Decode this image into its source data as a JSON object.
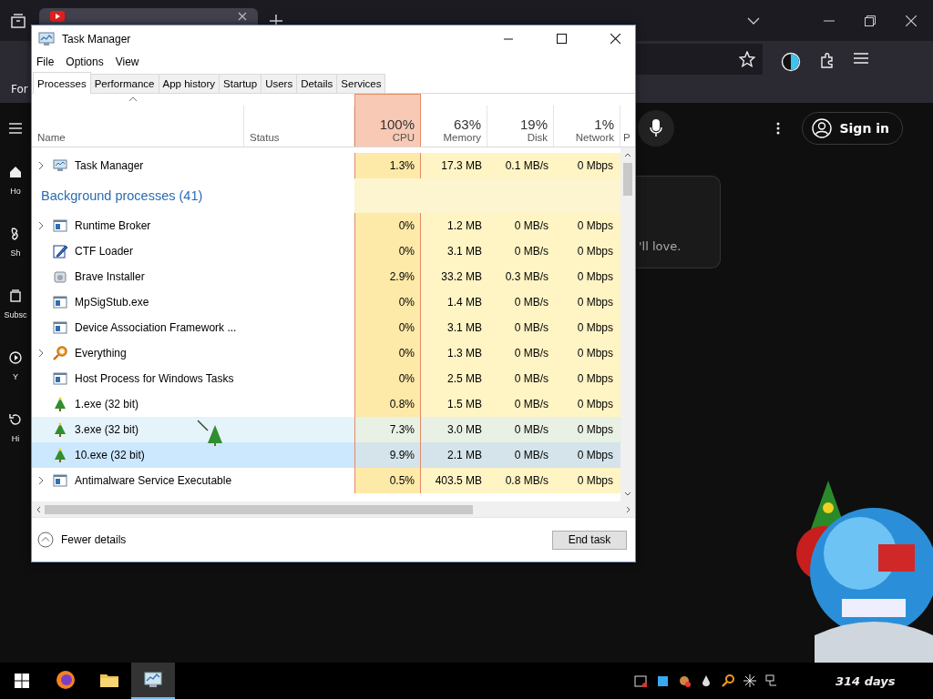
{
  "browser": {
    "side_text": "For",
    "sidebar": [
      {
        "label": "Ho"
      },
      {
        "label": "Sh"
      },
      {
        "label": "Subsc"
      },
      {
        "label": "Y"
      },
      {
        "label": "Hi"
      }
    ],
    "sign_in": "Sign in",
    "card_text": "'ll love."
  },
  "window": {
    "title": "Task Manager"
  },
  "menu": [
    "File",
    "Options",
    "View"
  ],
  "tabs": [
    {
      "label": "Processes",
      "selected": true
    },
    {
      "label": "Performance",
      "selected": false
    },
    {
      "label": "App history",
      "selected": false
    },
    {
      "label": "Startup",
      "selected": false
    },
    {
      "label": "Users",
      "selected": false
    },
    {
      "label": "Details",
      "selected": false
    },
    {
      "label": "Services",
      "selected": false
    }
  ],
  "columns": [
    {
      "label": "Name"
    },
    {
      "label": "Status"
    },
    {
      "percent": "100%",
      "label": "CPU",
      "alert": true
    },
    {
      "percent": "63%",
      "label": "Memory",
      "alert": false
    },
    {
      "percent": "19%",
      "label": "Disk",
      "alert": false
    },
    {
      "percent": "1%",
      "label": "Network",
      "alert": false
    },
    {
      "label": "P"
    }
  ],
  "rows": [
    {
      "kind": "process",
      "name": "Task Manager",
      "expandable": true,
      "selected": false,
      "hovered": false,
      "cpu": "1.3%",
      "memory": "17.3 MB",
      "disk": "0.1 MB/s",
      "network": "0 Mbps"
    },
    {
      "kind": "group",
      "name": "Background processes (41)"
    },
    {
      "kind": "process",
      "name": "Runtime Broker",
      "expandable": true,
      "selected": false,
      "hovered": false,
      "cpu": "0%",
      "memory": "1.2 MB",
      "disk": "0 MB/s",
      "network": "0 Mbps"
    },
    {
      "kind": "process",
      "name": "CTF Loader",
      "expandable": false,
      "selected": false,
      "hovered": false,
      "cpu": "0%",
      "memory": "3.1 MB",
      "disk": "0 MB/s",
      "network": "0 Mbps"
    },
    {
      "kind": "process",
      "name": "Brave Installer",
      "expandable": false,
      "selected": false,
      "hovered": false,
      "cpu": "2.9%",
      "memory": "33.2 MB",
      "disk": "0.3 MB/s",
      "network": "0 Mbps"
    },
    {
      "kind": "process",
      "name": "MpSigStub.exe",
      "expandable": false,
      "selected": false,
      "hovered": false,
      "cpu": "0%",
      "memory": "1.4 MB",
      "disk": "0 MB/s",
      "network": "0 Mbps"
    },
    {
      "kind": "process",
      "name": "Device Association Framework ...",
      "expandable": false,
      "selected": false,
      "hovered": false,
      "cpu": "0%",
      "memory": "3.1 MB",
      "disk": "0 MB/s",
      "network": "0 Mbps"
    },
    {
      "kind": "process",
      "name": "Everything",
      "expandable": true,
      "selected": false,
      "hovered": false,
      "cpu": "0%",
      "memory": "1.3 MB",
      "disk": "0 MB/s",
      "network": "0 Mbps"
    },
    {
      "kind": "process",
      "name": "Host Process for Windows Tasks",
      "expandable": false,
      "selected": false,
      "hovered": false,
      "cpu": "0%",
      "memory": "2.5 MB",
      "disk": "0 MB/s",
      "network": "0 Mbps"
    },
    {
      "kind": "process",
      "name": "1.exe (32 bit)",
      "expandable": false,
      "selected": false,
      "hovered": false,
      "cpu": "0.8%",
      "memory": "1.5 MB",
      "disk": "0 MB/s",
      "network": "0 Mbps"
    },
    {
      "kind": "process",
      "name": "3.exe (32 bit)",
      "expandable": false,
      "selected": false,
      "hovered": true,
      "cpu": "7.3%",
      "memory": "3.0 MB",
      "disk": "0 MB/s",
      "network": "0 Mbps"
    },
    {
      "kind": "process",
      "name": "10.exe (32 bit)",
      "expandable": false,
      "selected": true,
      "hovered": false,
      "cpu": "9.9%",
      "memory": "2.1 MB",
      "disk": "0 MB/s",
      "network": "0 Mbps"
    },
    {
      "kind": "process",
      "name": "Antimalware Service Executable",
      "expandable": true,
      "selected": false,
      "hovered": false,
      "cpu": "0.5%",
      "memory": "403.5 MB",
      "disk": "0.8 MB/s",
      "network": "0 Mbps"
    }
  ],
  "footer": {
    "details_label": "Fewer details",
    "end_task": "End task"
  },
  "taskbar": {
    "apps": [
      {
        "selected": false
      },
      {
        "selected": false
      },
      {
        "selected": true
      }
    ],
    "counter": "314 days"
  }
}
